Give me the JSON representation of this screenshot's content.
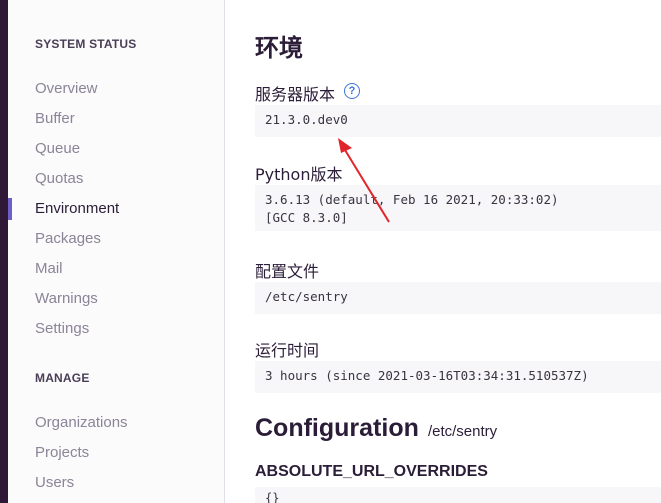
{
  "sidebar": {
    "system_status_heading": "SYSTEM STATUS",
    "items": [
      {
        "label": "Overview"
      },
      {
        "label": "Buffer"
      },
      {
        "label": "Queue"
      },
      {
        "label": "Quotas"
      },
      {
        "label": "Environment",
        "active": true
      },
      {
        "label": "Packages"
      },
      {
        "label": "Mail"
      },
      {
        "label": "Warnings"
      },
      {
        "label": "Settings"
      }
    ],
    "manage_heading": "MANAGE",
    "manage_items": [
      {
        "label": "Organizations"
      },
      {
        "label": "Projects"
      },
      {
        "label": "Users"
      }
    ]
  },
  "main": {
    "title": "环境",
    "server_version": {
      "label": "服务器版本",
      "value": "21.3.0.dev0"
    },
    "python_version": {
      "label": "Python版本",
      "value": "3.6.13 (default, Feb 16 2021, 20:33:02)\n[GCC 8.3.0]"
    },
    "config_file": {
      "label": "配置文件",
      "value": "/etc/sentry"
    },
    "uptime": {
      "label": "运行时间",
      "value": "3 hours (since 2021-03-16T03:34:31.510537Z)"
    },
    "configuration": {
      "title": "Configuration",
      "path": "/etc/sentry",
      "option_name": "ABSOLUTE_URL_OVERRIDES",
      "option_value": "{}"
    }
  },
  "colors": {
    "accent": "#6c5fc7",
    "help_icon": "#3d74db",
    "annotation_arrow": "#e0252b"
  },
  "icons": {
    "help": "question-circle-icon"
  }
}
